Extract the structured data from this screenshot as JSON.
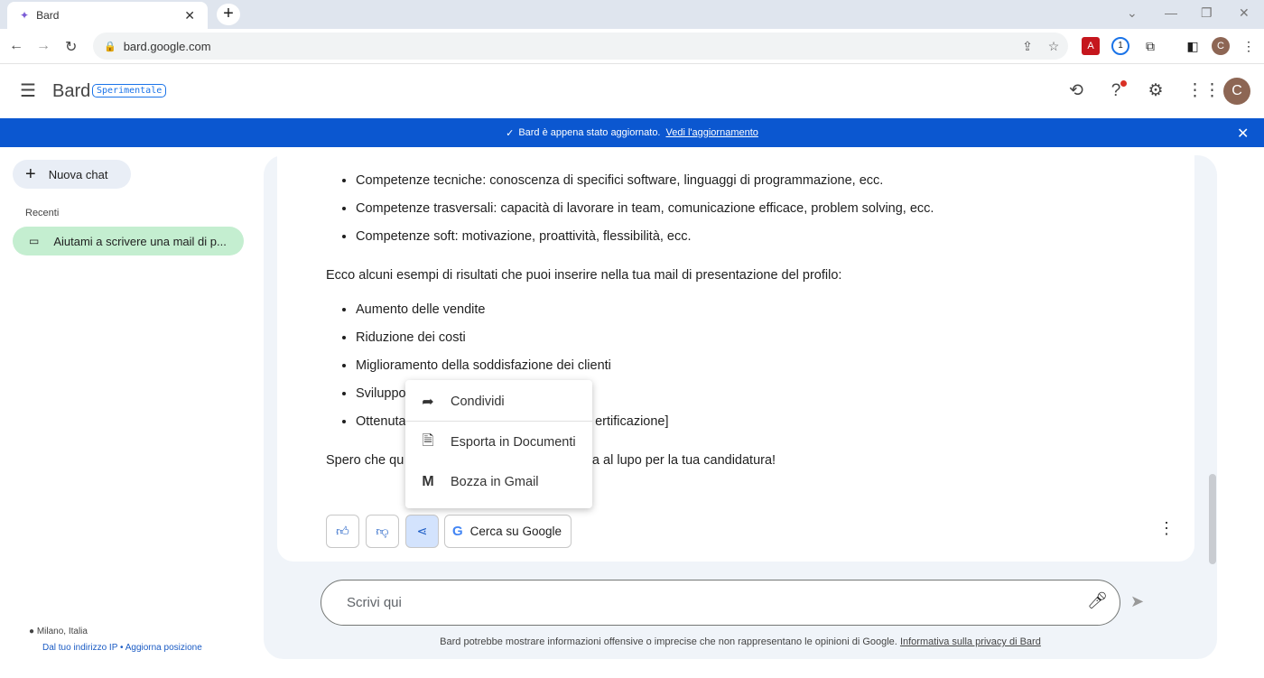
{
  "browser": {
    "tab_title": "Bard",
    "url": "bard.google.com",
    "profile_initial": "C"
  },
  "app": {
    "name": "Bard",
    "badge": "Sperimentale",
    "avatar_initial": "C"
  },
  "banner": {
    "text": "Bard è appena stato aggiornato.",
    "link": "Vedi l'aggiornamento"
  },
  "sidebar": {
    "new_chat": "Nuova chat",
    "recent_label": "Recenti",
    "recent_items": [
      "Aiutami a scrivere una mail di p..."
    ],
    "location": "Milano, Italia",
    "location_source": "Dal tuo indirizzo IP",
    "update_location": "Aggiorna posizione"
  },
  "response": {
    "bullets1": [
      "Competenze tecniche: conoscenza di specifici software, linguaggi di programmazione, ecc.",
      "Competenze trasversali: capacità di lavorare in team, comunicazione efficace, problem solving, ecc.",
      "Competenze soft: motivazione, proattività, flessibilità, ecc."
    ],
    "intro2": "Ecco alcuni esempi di risultati che puoi inserire nella tua mail di presentazione del profilo:",
    "bullets2": [
      "Aumento delle vendite",
      "Riduzione dei costi",
      "Miglioramento della soddisfazione dei clienti",
      "Sviluppo",
      "Ottenuta                                                    ertificazione]"
    ],
    "closing": "Spero che qu                                                  ca al lupo per la tua candidatura!"
  },
  "actions": {
    "google_search": "Cerca su Google"
  },
  "share_menu": [
    "Condividi",
    "Esporta in Documenti",
    "Bozza in Gmail"
  ],
  "input": {
    "placeholder": "Scrivi qui"
  },
  "footer": {
    "disclaimer": "Bard potrebbe mostrare informazioni offensive o imprecise che non rappresentano le opinioni di Google.",
    "privacy_link": "Informativa sulla privacy di Bard"
  }
}
